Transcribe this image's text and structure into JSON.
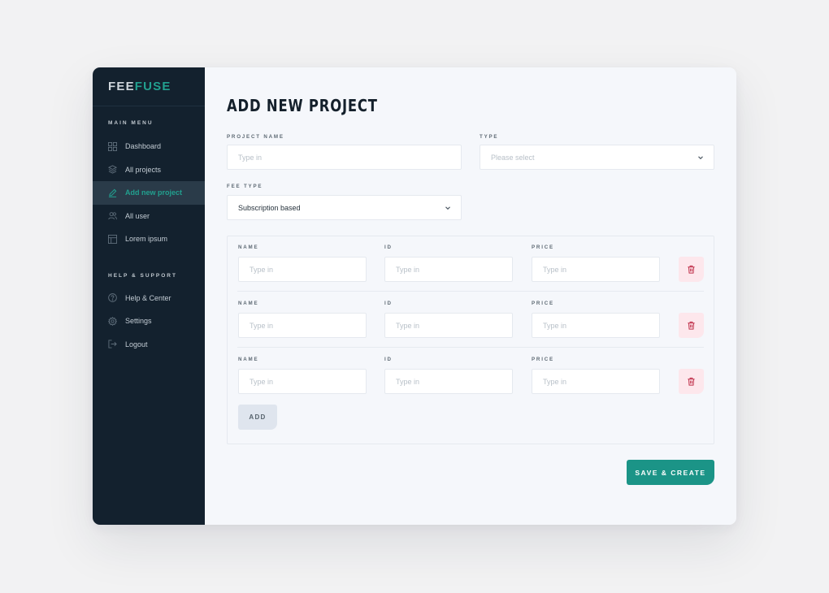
{
  "brand": {
    "part1": "FEE",
    "part2": "FUSE",
    "color1": "#cfd6dc",
    "color2": "#22a08f"
  },
  "sidebar": {
    "main_menu_title": "MAIN MENU",
    "main_items": [
      {
        "label": "Dashboard",
        "icon": "dashboard-icon",
        "active": false
      },
      {
        "label": "All projects",
        "icon": "layers-icon",
        "active": false
      },
      {
        "label": "Add new project",
        "icon": "edit-icon",
        "active": true
      },
      {
        "label": "All user",
        "icon": "users-icon",
        "active": false
      },
      {
        "label": "Lorem ipsum",
        "icon": "table-icon",
        "active": false
      }
    ],
    "help_title": "HELP & SUPPORT",
    "help_items": [
      {
        "label": "Help & Center",
        "icon": "help-icon"
      },
      {
        "label": "Settings",
        "icon": "gear-icon"
      },
      {
        "label": "Logout",
        "icon": "logout-icon"
      }
    ]
  },
  "main": {
    "title": "ADD NEW PROJECT",
    "project_name": {
      "label": "PROJECT NAME",
      "placeholder": "Type in"
    },
    "type": {
      "label": "TYPE",
      "placeholder": "Please select"
    },
    "fee_type": {
      "label": "FEE TYPE",
      "value": "Subscription based"
    },
    "rows": [
      {
        "name_label": "NAME",
        "id_label": "ID",
        "price_label": "PRICE",
        "name_placeholder": "Type in",
        "id_placeholder": "Type in",
        "price_placeholder": "Type in"
      },
      {
        "name_label": "NAME",
        "id_label": "ID",
        "price_label": "PRICE",
        "name_placeholder": "Type in",
        "id_placeholder": "Type in",
        "price_placeholder": "Type in"
      },
      {
        "name_label": "NAME",
        "id_label": "ID",
        "price_label": "PRICE",
        "name_placeholder": "Type in",
        "id_placeholder": "Type in",
        "price_placeholder": "Type in"
      }
    ],
    "add_label": "ADD",
    "save_label": "SAVE & CREATE"
  },
  "colors": {
    "accent": "#1b9487",
    "sidebar_bg": "#13212e",
    "danger": "#c0304a",
    "danger_bg": "#fde7ec"
  }
}
